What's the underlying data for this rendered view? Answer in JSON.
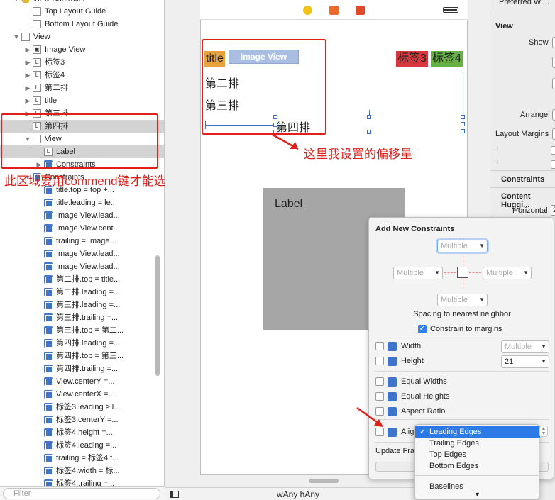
{
  "navigator": {
    "partial_top_row": "View Controller",
    "rows": [
      {
        "label": "Top Layout Guide",
        "indent": 2,
        "icon": "F",
        "tri": ""
      },
      {
        "label": "Bottom Layout Guide",
        "indent": 2,
        "icon": "F",
        "tri": ""
      },
      {
        "label": "View",
        "indent": 1,
        "icon": "F",
        "tri": "▼"
      },
      {
        "label": "Image View",
        "indent": 2,
        "icon": "I",
        "tri": "▶"
      },
      {
        "label": "标签3",
        "indent": 2,
        "icon": "L",
        "tri": "▶"
      },
      {
        "label": "标签4",
        "indent": 2,
        "icon": "L",
        "tri": "▶"
      },
      {
        "label": "第二排",
        "indent": 2,
        "icon": "L",
        "tri": "▶"
      },
      {
        "label": "title",
        "indent": 2,
        "icon": "L",
        "tri": "▶"
      },
      {
        "label": "第三排",
        "indent": 2,
        "icon": "L",
        "tri": "▶"
      },
      {
        "label": "第四排",
        "indent": 2,
        "icon": "L",
        "tri": "",
        "selected": true
      },
      {
        "label": "View",
        "indent": 2,
        "icon": "F",
        "tri": "▼"
      },
      {
        "label": "Label",
        "indent": 3,
        "icon": "L",
        "tri": "",
        "selected": true
      },
      {
        "label": "Constraints",
        "indent": 3,
        "icon": "C",
        "tri": "▶"
      },
      {
        "label": "Constraints",
        "indent": 2,
        "icon": "C",
        "tri": "▼"
      },
      {
        "label": "title.top = top +...",
        "indent": 3,
        "icon": "C",
        "tri": ""
      },
      {
        "label": "title.leading = le...",
        "indent": 3,
        "icon": "C",
        "tri": ""
      },
      {
        "label": "Image View.lead...",
        "indent": 3,
        "icon": "C",
        "tri": ""
      },
      {
        "label": "Image View.cent...",
        "indent": 3,
        "icon": "C",
        "tri": ""
      },
      {
        "label": "trailing = Image...",
        "indent": 3,
        "icon": "C",
        "tri": ""
      },
      {
        "label": "Image View.lead...",
        "indent": 3,
        "icon": "C",
        "tri": ""
      },
      {
        "label": "Image View.lead...",
        "indent": 3,
        "icon": "C",
        "tri": ""
      },
      {
        "label": "第二排.top = title...",
        "indent": 3,
        "icon": "C",
        "tri": ""
      },
      {
        "label": "第二排.leading =...",
        "indent": 3,
        "icon": "C",
        "tri": ""
      },
      {
        "label": "第三排.leading =...",
        "indent": 3,
        "icon": "C",
        "tri": ""
      },
      {
        "label": "第三排.trailing =...",
        "indent": 3,
        "icon": "C",
        "tri": ""
      },
      {
        "label": "第三排.top = 第二...",
        "indent": 3,
        "icon": "C",
        "tri": ""
      },
      {
        "label": "第四排.leading =...",
        "indent": 3,
        "icon": "C",
        "tri": ""
      },
      {
        "label": "第四排.top = 第三...",
        "indent": 3,
        "icon": "C",
        "tri": ""
      },
      {
        "label": "第四排.trailing =...",
        "indent": 3,
        "icon": "C",
        "tri": ""
      },
      {
        "label": "View.centerY =...",
        "indent": 3,
        "icon": "C",
        "tri": ""
      },
      {
        "label": "View.centerX =...",
        "indent": 3,
        "icon": "C",
        "tri": ""
      },
      {
        "label": "标签3.leading ≥ l...",
        "indent": 3,
        "icon": "C",
        "tri": ""
      },
      {
        "label": "标签3.centerY =...",
        "indent": 3,
        "icon": "C",
        "tri": ""
      },
      {
        "label": "标签4.height =...",
        "indent": 3,
        "icon": "C",
        "tri": ""
      },
      {
        "label": "标签4.leading =...",
        "indent": 3,
        "icon": "C",
        "tri": ""
      },
      {
        "label": "trailing = 标签4.t...",
        "indent": 3,
        "icon": "C",
        "tri": ""
      },
      {
        "label": "标签4.width = 标...",
        "indent": 3,
        "icon": "C",
        "tri": ""
      },
      {
        "label": "标签4.trailing =...",
        "indent": 3,
        "icon": "C",
        "tri": ""
      }
    ],
    "filter_placeholder": "Filter"
  },
  "annotations": {
    "left_note": "此区域要用commend键才能选中",
    "offset_note": "这里我设置的偏移量"
  },
  "scene": {
    "title_label": "title",
    "image_view_label": "Image View",
    "tag3": "标签3",
    "tag4": "标签4",
    "row2": "第二排",
    "row3": "第三排",
    "row4": "第四排",
    "gray_label": "Label"
  },
  "bottom_bar": {
    "size_class": "wAny hAny"
  },
  "inspector": {
    "preferred_width": "Preferred Wi...",
    "view_header": "View",
    "show": "Show",
    "arrange": "Arrange",
    "layout_margins": "Layout Margins",
    "constraints_header": "Constraints",
    "content_hugging_header": "Content Huggi...",
    "horizontal": "Horizontal",
    "horizontal_value": "2"
  },
  "popover": {
    "title": "Add New Constraints",
    "top_value": "Multiple",
    "left_value": "Multiple",
    "right_value": "Multiple",
    "bottom_value": "Multiple",
    "spacing_caption": "Spacing to nearest neighbor",
    "constrain_margins": "Constrain to margins",
    "width_label": "Width",
    "width_value": "Multiple",
    "height_label": "Height",
    "height_value": "21",
    "equal_widths": "Equal Widths",
    "equal_heights": "Equal Heights",
    "aspect_ratio": "Aspect Ratio",
    "align_label": "Align",
    "update_frames": "Update Frames"
  },
  "align_menu": {
    "items": [
      "Leading Edges",
      "Trailing Edges",
      "Top Edges",
      "Bottom Edges",
      "Baselines"
    ],
    "checked": "Leading Edges"
  },
  "colors": {
    "annotation_red": "#e0201a",
    "title_bg": "#e8a23a",
    "tag3_bg": "#d9363e",
    "tag4_bg": "#67b044",
    "image_view_bg": "#a9bee0",
    "gray_view": "#a6a6a6",
    "selection_blue": "#2b7ae8"
  }
}
